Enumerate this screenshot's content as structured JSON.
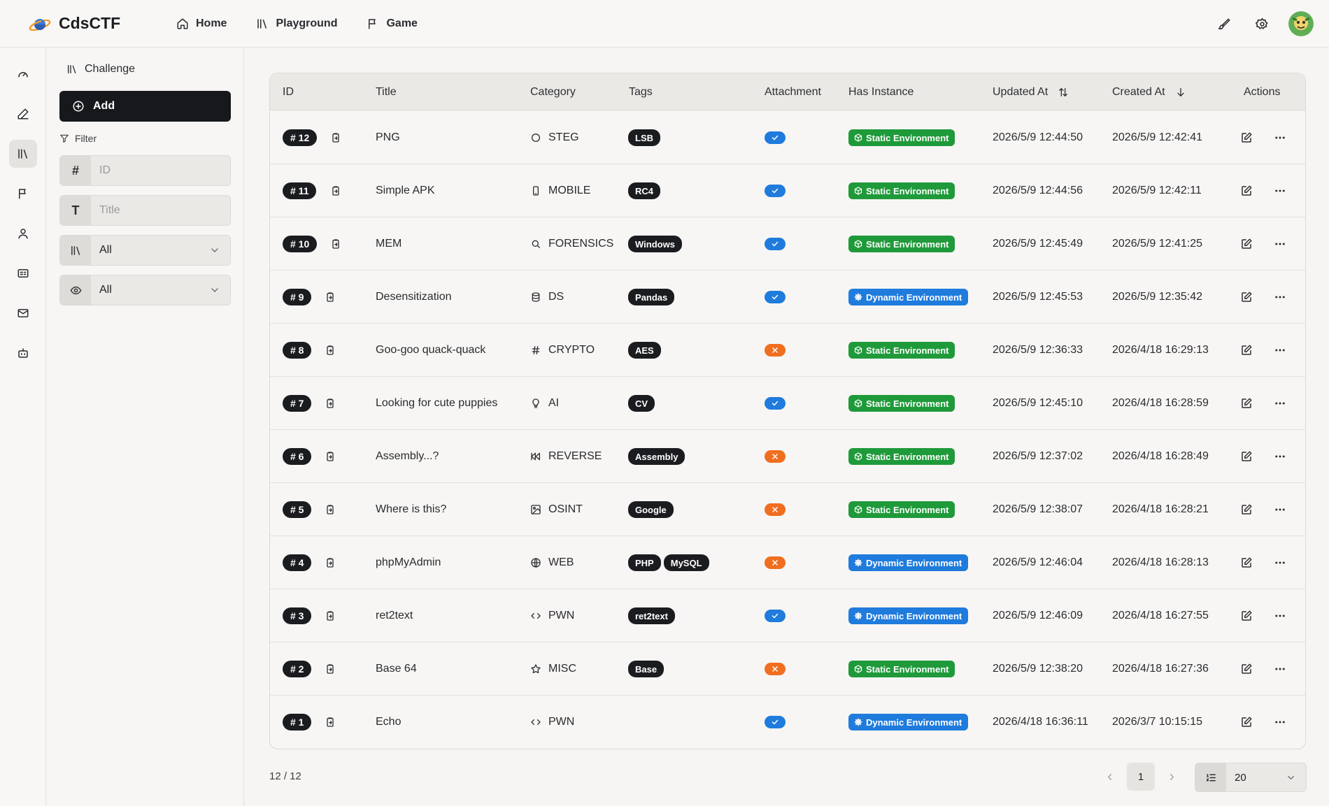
{
  "app": {
    "brand": "CdsCTF",
    "nav": [
      {
        "label": "Home",
        "icon": "home-icon"
      },
      {
        "label": "Playground",
        "icon": "library-icon"
      },
      {
        "label": "Game",
        "icon": "flag-icon"
      }
    ]
  },
  "panel": {
    "title": "Challenge",
    "add_label": "Add",
    "filter_label": "Filter",
    "id_placeholder": "ID",
    "title_placeholder": "Title",
    "category_value": "All",
    "visibility_value": "All"
  },
  "table": {
    "headers": {
      "id": "ID",
      "title": "Title",
      "category": "Category",
      "tags": "Tags",
      "attachment": "Attachment",
      "has_instance": "Has Instance",
      "updated_at": "Updated At",
      "created_at": "Created At",
      "actions": "Actions"
    },
    "rows": [
      {
        "id": "# 12",
        "title": "PNG",
        "category": "STEG",
        "cat_icon": "circle-icon",
        "tags": [
          "LSB"
        ],
        "attachment": true,
        "env": "Static Environment",
        "env_type": "static",
        "updated": "2026/5/9 12:44:50",
        "created": "2026/5/9 12:42:41"
      },
      {
        "id": "# 11",
        "title": "Simple APK",
        "category": "MOBILE",
        "cat_icon": "smartphone-icon",
        "tags": [
          "RC4"
        ],
        "attachment": true,
        "env": "Static Environment",
        "env_type": "static",
        "updated": "2026/5/9 12:44:56",
        "created": "2026/5/9 12:42:11"
      },
      {
        "id": "# 10",
        "title": "MEM",
        "category": "FORENSICS",
        "cat_icon": "search-icon",
        "tags": [
          "Windows"
        ],
        "attachment": true,
        "env": "Static Environment",
        "env_type": "static",
        "updated": "2026/5/9 12:45:49",
        "created": "2026/5/9 12:41:25"
      },
      {
        "id": "# 9",
        "title": "Desensitization",
        "category": "DS",
        "cat_icon": "database-icon",
        "tags": [
          "Pandas"
        ],
        "attachment": true,
        "env": "Dynamic Environment",
        "env_type": "dynamic",
        "updated": "2026/5/9 12:45:53",
        "created": "2026/5/9 12:35:42"
      },
      {
        "id": "# 8",
        "title": "Goo-goo quack-quack",
        "category": "CRYPTO",
        "cat_icon": "hash-icon",
        "tags": [
          "AES"
        ],
        "attachment": false,
        "env": "Static Environment",
        "env_type": "static",
        "updated": "2026/5/9 12:36:33",
        "created": "2026/4/18 16:29:13"
      },
      {
        "id": "# 7",
        "title": "Looking for cute puppies",
        "category": "AI",
        "cat_icon": "lightbulb-icon",
        "tags": [
          "CV"
        ],
        "attachment": true,
        "env": "Static Environment",
        "env_type": "static",
        "updated": "2026/5/9 12:45:10",
        "created": "2026/4/18 16:28:59"
      },
      {
        "id": "# 6",
        "title": "Assembly...?",
        "category": "REVERSE",
        "cat_icon": "rewind-icon",
        "tags": [
          "Assembly"
        ],
        "attachment": false,
        "env": "Static Environment",
        "env_type": "static",
        "updated": "2026/5/9 12:37:02",
        "created": "2026/4/18 16:28:49"
      },
      {
        "id": "# 5",
        "title": "Where is this?",
        "category": "OSINT",
        "cat_icon": "image-icon",
        "tags": [
          "Google"
        ],
        "attachment": false,
        "env": "Static Environment",
        "env_type": "static",
        "updated": "2026/5/9 12:38:07",
        "created": "2026/4/18 16:28:21"
      },
      {
        "id": "# 4",
        "title": "phpMyAdmin",
        "category": "WEB",
        "cat_icon": "globe-icon",
        "tags": [
          "PHP",
          "MySQL"
        ],
        "attachment": false,
        "env": "Dynamic Environment",
        "env_type": "dynamic",
        "updated": "2026/5/9 12:46:04",
        "created": "2026/4/18 16:28:13"
      },
      {
        "id": "# 3",
        "title": "ret2text",
        "category": "PWN",
        "cat_icon": "code-icon",
        "tags": [
          "ret2text"
        ],
        "attachment": true,
        "env": "Dynamic Environment",
        "env_type": "dynamic",
        "updated": "2026/5/9 12:46:09",
        "created": "2026/4/18 16:27:55"
      },
      {
        "id": "# 2",
        "title": "Base 64",
        "category": "MISC",
        "cat_icon": "star-icon",
        "tags": [
          "Base"
        ],
        "attachment": false,
        "env": "Static Environment",
        "env_type": "static",
        "updated": "2026/5/9 12:38:20",
        "created": "2026/4/18 16:27:36"
      },
      {
        "id": "# 1",
        "title": "Echo",
        "category": "PWN",
        "cat_icon": "code-icon",
        "tags": [],
        "attachment": true,
        "env": "Dynamic Environment",
        "env_type": "dynamic",
        "updated": "2026/4/18 16:36:11",
        "created": "2026/3/7 10:15:15"
      }
    ]
  },
  "footer": {
    "count": "12 / 12",
    "page": "1",
    "page_size": "20"
  },
  "colors": {
    "static_env": "#1f9a3a",
    "dynamic_env": "#1f7bdc",
    "attachment_yes": "#1f7bdc",
    "attachment_no": "#f06e20"
  }
}
